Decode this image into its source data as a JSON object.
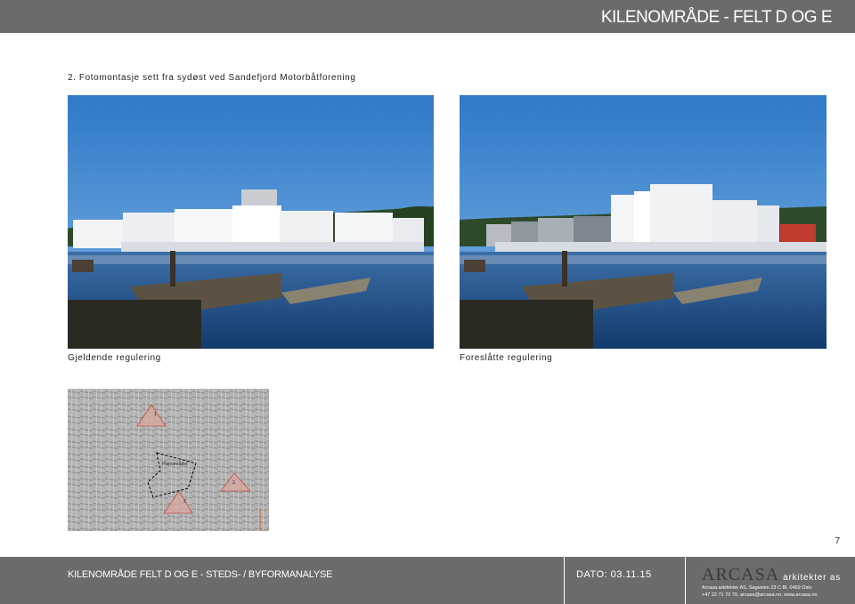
{
  "header": {
    "title": "KILENOMRÅDE - FELT D OG E"
  },
  "section_title": "2. Fotomontasje sett fra sydøst ved Sandefjord Motorbåtforening",
  "photos": {
    "left_caption": "Gjeldende regulering",
    "right_caption": "Foreslåtte regulering"
  },
  "map": {
    "label_main": "Planområdet",
    "marker_1": "1",
    "marker_2": "2",
    "marker_3": "3"
  },
  "page_number": "7",
  "footer": {
    "project": "KILENOMRÅDE FELT D OG E - STEDS- / BYFORMANALYSE",
    "date": "DATO: 03.11.15",
    "brand": "ARCASA",
    "brand_sub": "arkitekter as",
    "address_line1": "Arcasa arkitekter AS, Sagveien 23 C Bl, 0459 Oslo",
    "address_line2": "+47 22 71 70 70, arcasa@arcasa.no, www.arcasa.no"
  },
  "colors": {
    "bar": "#6b6b6b",
    "sky": "#3f87d0",
    "water": "#1f4f8a"
  }
}
